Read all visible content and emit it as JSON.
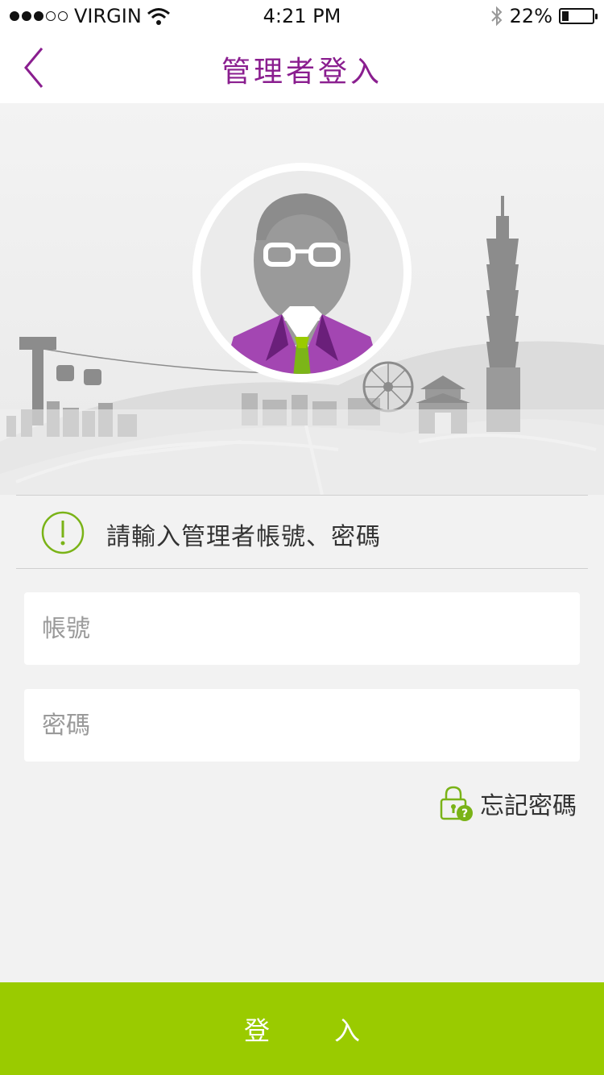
{
  "status_bar": {
    "carrier": "VIRGIN",
    "time": "4:21 PM",
    "battery_percent": "22%",
    "battery_level": 0.22,
    "icons": [
      "signal-dots-icon",
      "wifi-icon",
      "bluetooth-icon",
      "battery-icon"
    ]
  },
  "nav": {
    "title": "管理者登入",
    "back_icon": "chevron-left-icon",
    "accent_color": "#8a1e8f"
  },
  "hero": {
    "avatar_icon": "admin-avatar-icon",
    "background": "taipei-skyline-illustration"
  },
  "notice": {
    "icon": "alert-circle-icon",
    "text": "請輸入管理者帳號、密碼",
    "icon_color": "#7ab317"
  },
  "form": {
    "account_placeholder": "帳號",
    "password_placeholder": "密碼",
    "forgot_icon": "lock-question-icon",
    "forgot_label": "忘記密碼"
  },
  "login_button": {
    "label": "登入",
    "color": "#9acb00"
  }
}
